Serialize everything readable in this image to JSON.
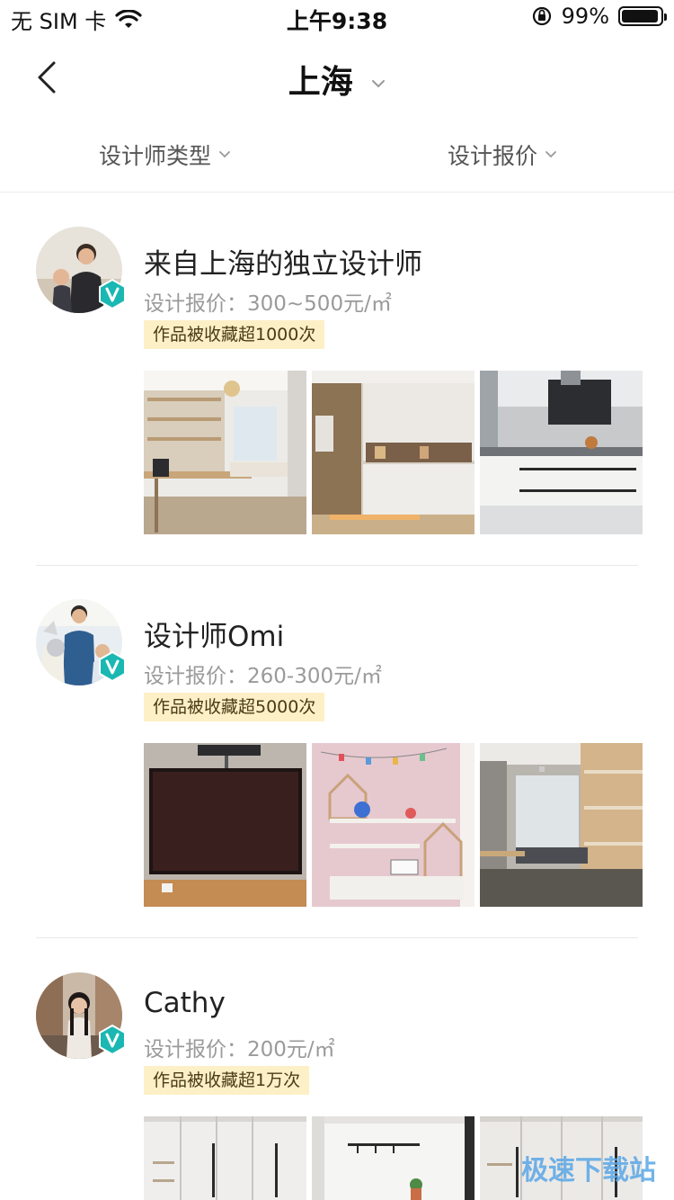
{
  "status_bar": {
    "carrier": "无 SIM 卡",
    "time": "上午9:38",
    "battery_percent": "99%",
    "battery_level": 0.99
  },
  "nav": {
    "title": "上海"
  },
  "filters": {
    "designer_type": "设计师类型",
    "design_price": "设计报价"
  },
  "designers": [
    {
      "name": "来自上海的独立设计师",
      "price": "设计报价：300~500元/㎡",
      "collect_tag": "作品被收藏超1000次"
    },
    {
      "name": "设计师Omi",
      "price": "设计报价：260-300元/㎡",
      "collect_tag": "作品被收藏超5000次"
    },
    {
      "name": "Cathy",
      "price": "设计报价：200元/㎡",
      "collect_tag": "作品被收藏超1万次"
    }
  ],
  "watermark": "极速下载站",
  "colors": {
    "badge": "#1bb8b3",
    "tag_bg": "#fdf0c6"
  }
}
